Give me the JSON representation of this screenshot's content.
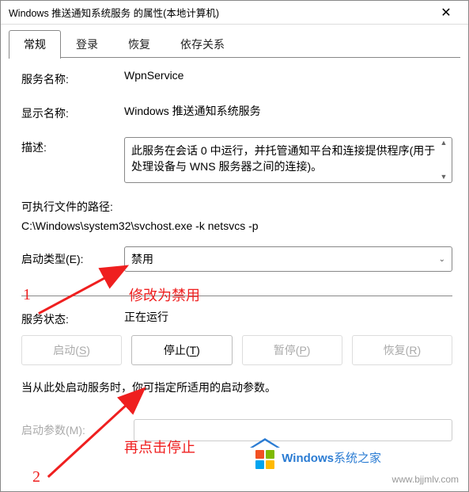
{
  "window": {
    "title": "Windows 推送通知系统服务 的属性(本地计算机)"
  },
  "tabs": {
    "general": "常规",
    "logon": "登录",
    "recovery": "恢复",
    "deps": "依存关系"
  },
  "labels": {
    "service_name": "服务名称:",
    "display_name": "显示名称:",
    "description": "描述:",
    "exec_path": "可执行文件的路径:",
    "startup_type": "启动类型(E):",
    "service_status": "服务状态:",
    "start_params": "启动参数(M):"
  },
  "values": {
    "service_name": "WpnService",
    "display_name": "Windows 推送通知系统服务",
    "description": "此服务在会话 0 中运行，并托管通知平台和连接提供程序(用于处理设备与 WNS 服务器之间的连接)。",
    "exec_path": "C:\\Windows\\system32\\svchost.exe -k netsvcs -p",
    "startup_type": "禁用",
    "service_status": "正在运行",
    "start_params": ""
  },
  "buttons": {
    "start": {
      "text_pre": "启动(",
      "hot": "S",
      "text_post": ")"
    },
    "stop": {
      "text_pre": "停止(",
      "hot": "T",
      "text_post": ")"
    },
    "pause": {
      "text_pre": "暂停(",
      "hot": "P",
      "text_post": ")"
    },
    "resume": {
      "text_pre": "恢复(",
      "hot": "R",
      "text_post": ")"
    }
  },
  "hint": "当从此处启动服务时，你可指定所适用的启动参数。",
  "annotations": {
    "num1": "1",
    "num2": "2",
    "tip1": "修改为禁用",
    "tip2": "再点击停止"
  },
  "watermark": {
    "brand_bold": "Windows",
    "brand_rest": "系统之家",
    "url": "www.bjjmlv.com"
  }
}
